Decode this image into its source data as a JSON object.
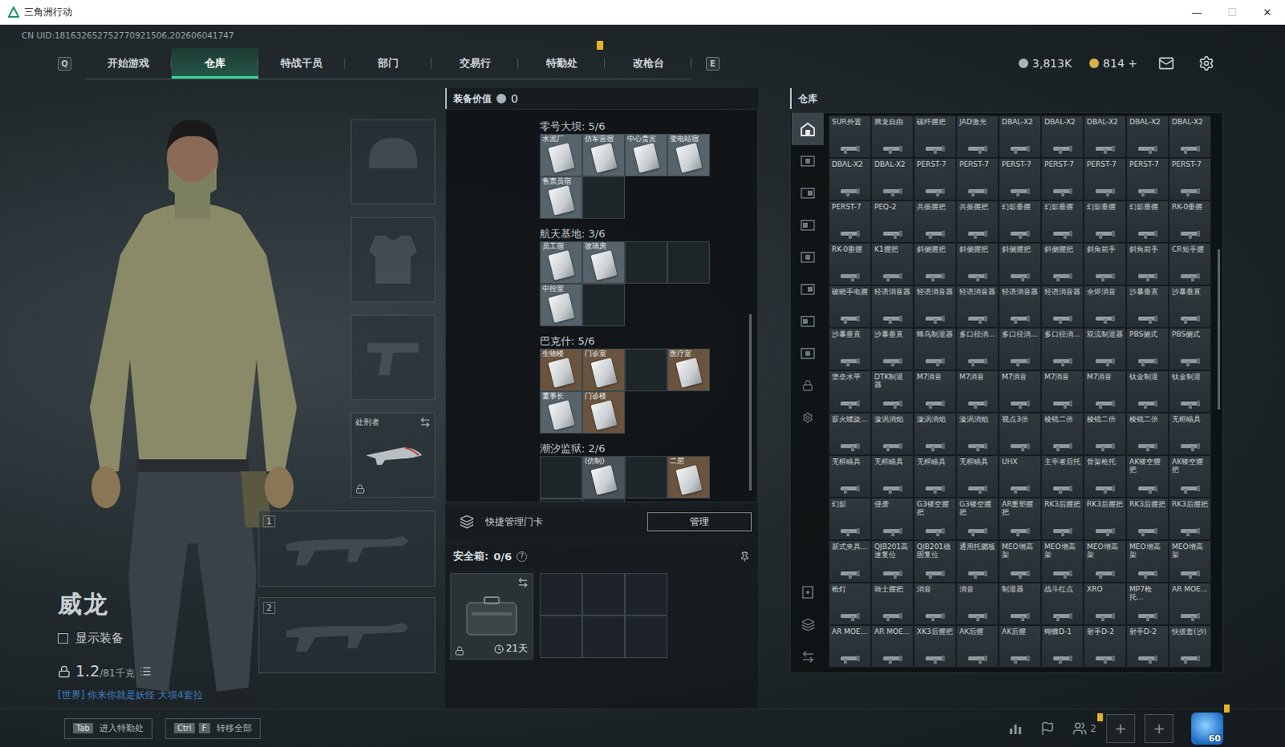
{
  "window": {
    "title": "三角洲行动",
    "controls": [
      {
        "glyph": "—",
        "disabled": false
      },
      {
        "glyph": "☐",
        "disabled": true
      },
      {
        "glyph": "✕",
        "disabled": false
      }
    ]
  },
  "uid": "CN UID:181632652752770921506,202606041747",
  "nav": {
    "prevKey": "Q",
    "nextKey": "E",
    "tabs": [
      {
        "label": "开始游戏",
        "selected": false,
        "badge": false
      },
      {
        "label": "仓库",
        "selected": true,
        "badge": false
      },
      {
        "label": "特战干员",
        "selected": false,
        "badge": false
      },
      {
        "label": "部门",
        "selected": false,
        "badge": false
      },
      {
        "label": "交易行",
        "selected": false,
        "badge": false
      },
      {
        "label": "特勤处",
        "selected": false,
        "badge": true
      },
      {
        "label": "改枪台",
        "selected": false,
        "badge": false
      }
    ]
  },
  "currency": [
    {
      "amount": "3,813K",
      "color": "#a9b3b8"
    },
    {
      "amount": "814 +",
      "color": "#d9b24c"
    }
  ],
  "operator": {
    "name": "威龙",
    "showEquipment": {
      "label": "显示装备",
      "checked": false
    },
    "weight": {
      "value": "1.2",
      "capacity": "/81千克"
    },
    "chat": "[世界] 你来你就是妖怪 大坝4套拉"
  },
  "equipment": [
    {
      "kind": "helmet"
    },
    {
      "kind": "armor"
    },
    {
      "kind": "pistol"
    },
    {
      "kind": "melee",
      "label": "处刑者",
      "locked": true
    },
    {
      "kind": "weapon",
      "number": "1"
    },
    {
      "kind": "weapon",
      "number": "2"
    }
  ],
  "equipmentValue": {
    "label": "装备价值",
    "value": "0"
  },
  "keycards": [
    {
      "name": "零号大坝: 5/6",
      "slots": [
        {
          "label": "水泥厂",
          "filled": true,
          "color": "#56636b"
        },
        {
          "label": "仿军营宿",
          "filled": true,
          "color": "#56636b"
        },
        {
          "label": "中心贵宾",
          "filled": true,
          "color": "#56636b"
        },
        {
          "label": "变电站宿",
          "filled": true,
          "color": "#56636b"
        },
        {
          "label": "售票员宿",
          "filled": true,
          "color": "#56636b"
        },
        {
          "label": "",
          "filled": false,
          "color": "#1e2529"
        }
      ]
    },
    {
      "name": "航天基地: 3/6",
      "slots": [
        {
          "label": "员工宿",
          "filled": true,
          "color": "#56636b"
        },
        {
          "label": "玻璃房",
          "filled": true,
          "color": "#56636b"
        },
        {
          "label": "",
          "filled": false,
          "color": "#1e2529"
        },
        {
          "label": "",
          "filled": false,
          "color": "#1e2529"
        },
        {
          "label": "中控室",
          "filled": true,
          "color": "#56636b"
        },
        {
          "label": "",
          "filled": false,
          "color": "#1e2529"
        }
      ]
    },
    {
      "name": "巴克什: 5/6",
      "slots": [
        {
          "label": "生物楼",
          "filled": true,
          "color": "#6a5440"
        },
        {
          "label": "门诊室",
          "filled": true,
          "color": "#6a5440"
        },
        {
          "label": "",
          "filled": false,
          "color": "#1e2529"
        },
        {
          "label": "医疗室",
          "filled": true,
          "color": "#6a5440"
        },
        {
          "label": "董事长",
          "filled": true,
          "color": "#56636b"
        },
        {
          "label": "门诊楼",
          "filled": true,
          "color": "#6a5440"
        }
      ]
    },
    {
      "name": "潮汐监狱: 2/6",
      "slots": [
        {
          "label": "",
          "filled": false,
          "color": "#1e2529"
        },
        {
          "label": "(仿制)",
          "filled": true,
          "color": "#4a5358"
        },
        {
          "label": "",
          "filled": false,
          "color": "#1e2529"
        },
        {
          "label": "二层",
          "filled": true,
          "color": "#6a5440"
        },
        {
          "label": "",
          "filled": false,
          "color": "#1e2529"
        },
        {
          "label": "",
          "filled": false,
          "color": "#1e2529"
        }
      ]
    }
  ],
  "keyManager": {
    "label": "快捷管理门卡",
    "button": "管理"
  },
  "safeBox": {
    "label": "安全箱:",
    "count": "0/6",
    "help": "?",
    "days": "21天",
    "locked": true,
    "slots": [
      {
        "filled": false
      },
      {
        "filled": false
      },
      {
        "filled": false
      },
      {
        "filled": false
      },
      {
        "filled": false
      },
      {
        "filled": false
      }
    ]
  },
  "warehouse": {
    "title": "仓库",
    "sidebar": [
      {
        "selected": true
      },
      {
        "selected": false
      },
      {
        "selected": false
      },
      {
        "selected": false
      },
      {
        "selected": false
      },
      {
        "selected": false
      },
      {
        "selected": false
      },
      {
        "selected": false
      },
      {
        "selected": false
      },
      {
        "selected": false
      }
    ],
    "items": [
      "SUR外置",
      "腾龙自由",
      "碳纤握把",
      "JAD激光",
      "DBAL-X2",
      "DBAL-X2",
      "DBAL-X2",
      "DBAL-X2",
      "DBAL-X2",
      "DBAL-X2",
      "DBAL-X2",
      "PERST-7",
      "PERST-7",
      "PERST-7",
      "PERST-7",
      "PERST-7",
      "PERST-7",
      "PERST-7",
      "PERST-7",
      "PEQ-2",
      "共振握把",
      "共振握把",
      "幻影垂握",
      "幻影垂握",
      "幻影垂握",
      "幻影垂握",
      "RK-0垂握",
      "RK-0垂握",
      "K1握把",
      "斜侧握把",
      "斜侧握把",
      "斜侧握把",
      "斜侧握把",
      "斜角前手",
      "斜角前手",
      "CR短手握",
      "破晓手电握",
      "轻语消音器",
      "轻语消音器",
      "轻语消音器",
      "轻语消音器",
      "轻语消音器",
      "余烬消音",
      "沙暴垂直",
      "沙暴垂直",
      "沙暴垂直",
      "沙暴垂直",
      "蜂鸟制退器",
      "多口径消...",
      "多口径消...",
      "多口径消...",
      "双流制退器",
      "PBS侧式",
      "PBS侧式",
      "堡垒水平",
      "DTK制退器",
      "M7消音",
      "M7消音",
      "M7消音",
      "M7消音",
      "M7消音",
      "钛金制退",
      "钛金制退",
      "薪火螺旋...",
      "漩涡消焰",
      "漩涡消焰",
      "漩涡消焰",
      "视点3倍",
      "棱镜二倍",
      "棱镜二倍",
      "棱镜二倍",
      "无框瞄具",
      "无框瞄具",
      "无框瞄具",
      "无框瞄具",
      "无框瞄具",
      "UHX",
      "主宰者后托",
      "骨架枪托",
      "AK镂空握把",
      "AK镂空握把",
      "幻影",
      "侵袭",
      "G3镂空握把",
      "G3镂空握把",
      "AR重塑握把",
      "RK3后握把",
      "RK3后握把",
      "RK3后握把",
      "RK3后握把",
      "新式夹具...",
      "QJB201高速复位",
      "QJB201稳固复位",
      "通用托腮板",
      "MEO增高架",
      "MEO增高架",
      "MEO增高架",
      "MEO增高架",
      "MEO增高架",
      "枪灯",
      "骑士握把",
      "消音",
      "消音",
      "制退器",
      "战斗红点",
      "XRO",
      "MP7枪托...",
      "AR MOE...",
      "AR MOE...",
      "AR MOE...",
      "XK3后握把",
      "AK后握",
      "AK后握",
      "蝴蝶D-1",
      "射手D-2",
      "射手D-2",
      "快拔套(沙)"
    ]
  },
  "bottom": {
    "hotkeys": [
      {
        "keys": [
          "Tab"
        ],
        "label": "进入特勤处"
      },
      {
        "keys": [
          "Ctrl",
          "F"
        ],
        "label": "转移全部"
      }
    ],
    "party": {
      "count": "2",
      "badge": true
    },
    "invites": [
      "+",
      "+"
    ],
    "avatar": {
      "level": "60",
      "badge": true
    }
  }
}
